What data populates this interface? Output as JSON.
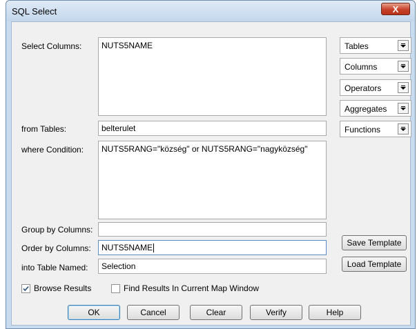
{
  "window": {
    "title": "SQL Select",
    "close_label": "X"
  },
  "labels": {
    "select_columns": "Select Columns:",
    "from_tables": "from Tables:",
    "where_condition": "where Condition:",
    "group_by": "Group by Columns:",
    "order_by": "Order by Columns:",
    "into_table": "into Table Named:"
  },
  "fields": {
    "select_columns": "NUTS5NAME",
    "from_tables": "belterulet",
    "where_condition": "NUTS5RANG=\"község\" or NUTS5RANG=\"nagyközség\"",
    "group_by": "",
    "order_by": "NUTS5NAME",
    "into_table": "Selection"
  },
  "dropdowns": [
    "Tables",
    "Columns",
    "Operators",
    "Aggregates",
    "Functions"
  ],
  "side_buttons": {
    "save_template": "Save Template",
    "load_template": "Load Template"
  },
  "checkboxes": {
    "browse_results": {
      "label": "Browse Results",
      "checked": true
    },
    "find_results": {
      "label": "Find Results In Current Map Window",
      "checked": false
    }
  },
  "buttons": {
    "ok": "OK",
    "cancel": "Cancel",
    "clear": "Clear",
    "verify": "Verify",
    "help": "Help"
  }
}
